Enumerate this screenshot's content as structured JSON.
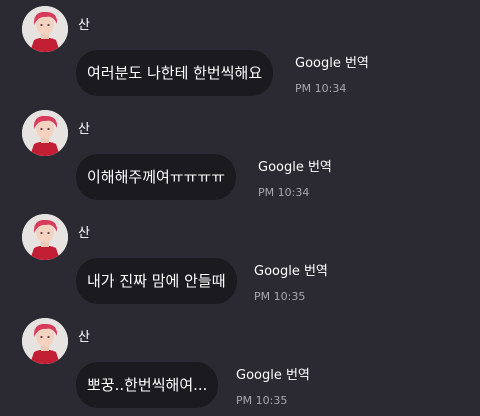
{
  "colors": {
    "background": "#2b2a33",
    "bubble": "#1b1a1f",
    "text": "#ffffff",
    "timestamp": "#a9a7b0",
    "avatar_hair": "#d83a5a",
    "avatar_jacket": "#c21e34"
  },
  "messages": [
    {
      "sender": "산",
      "text": "여러분도 나한테 한번씩해요",
      "translate_label": "Google 번역",
      "time": "PM 10:34"
    },
    {
      "sender": "산",
      "text": "이해해주께여ㅠㅠㅠㅠ",
      "translate_label": "Google 번역",
      "time": "PM 10:34"
    },
    {
      "sender": "산",
      "text": "내가 진짜 맘에 안들때",
      "translate_label": "Google 번역",
      "time": "PM 10:35"
    },
    {
      "sender": "산",
      "text": "뽀꿍..한번씩해여...",
      "translate_label": "Google 번역",
      "time": "PM 10:35"
    }
  ]
}
